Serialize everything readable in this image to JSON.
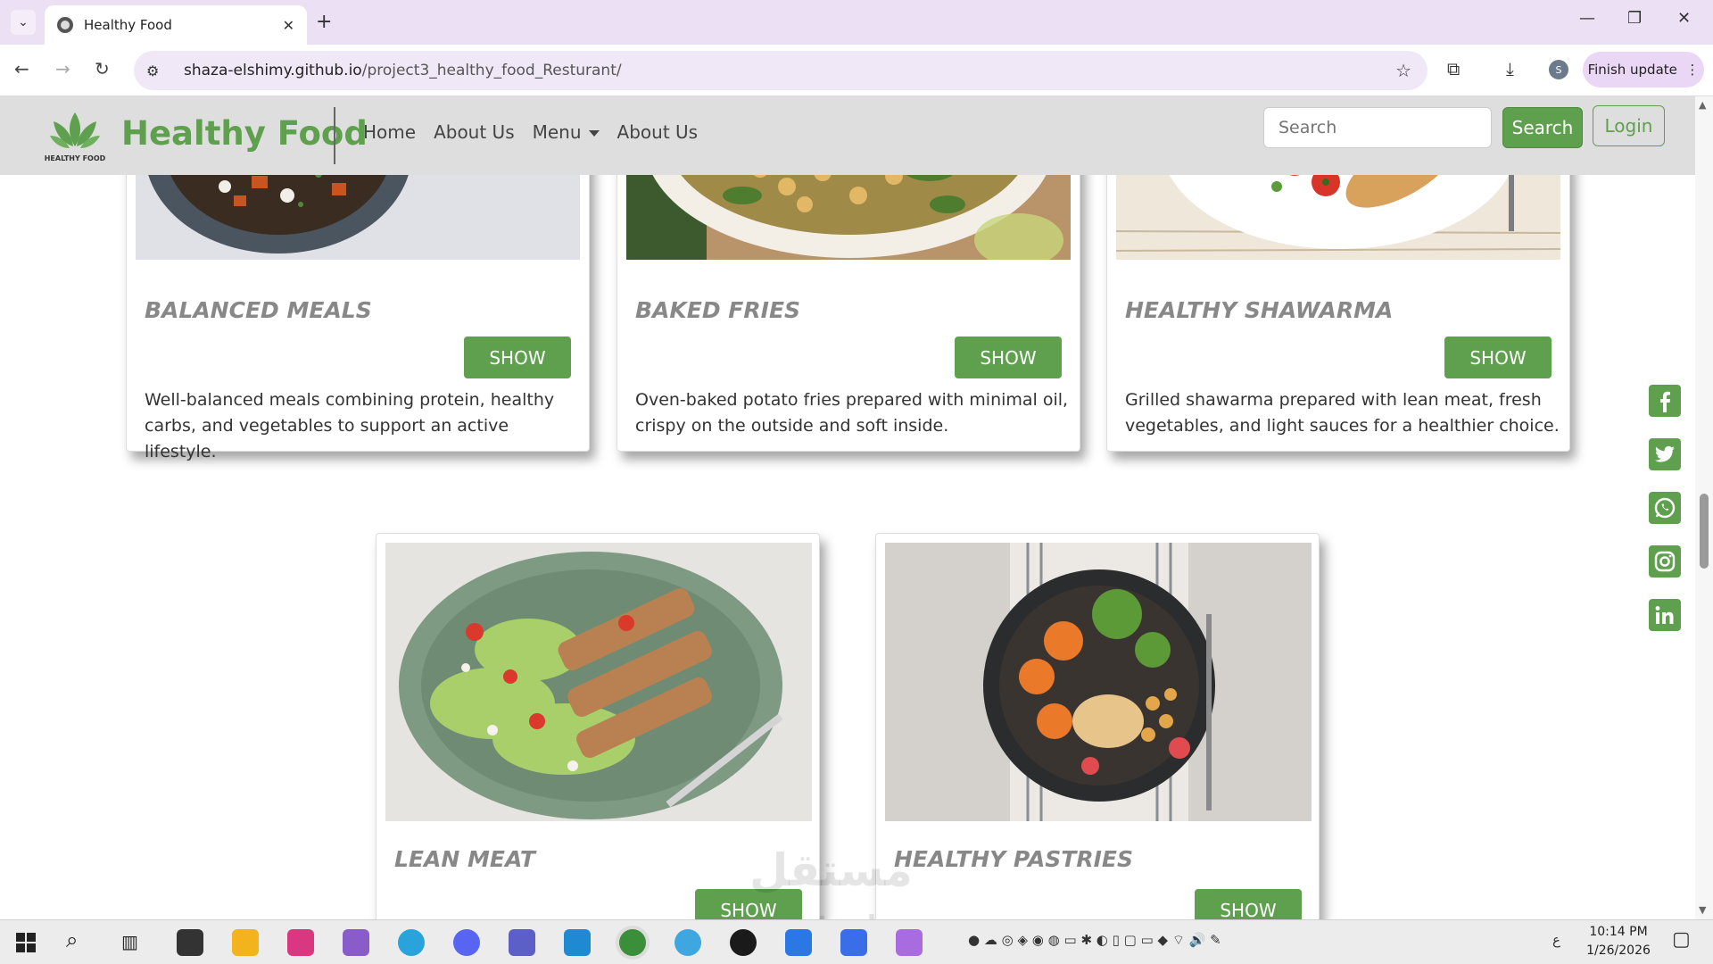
{
  "browser": {
    "tab_title": "Healthy Food",
    "tab_close": "✕",
    "new_tab": "+",
    "url_host": "shaza-elshimy.github.io",
    "url_path": "/project3_healthy_food_Resturant/",
    "profile_initial": "S",
    "finish_update": "Finish update"
  },
  "site": {
    "brand": "Healthy Food",
    "logo_text": "HEALTHY FOOD",
    "nav": [
      "Home",
      "About Us",
      "Menu",
      "About Us"
    ],
    "search_placeholder": "Search",
    "search_button": "Search",
    "login_button": "Login"
  },
  "cards": [
    {
      "title": "BALANCED MEALS",
      "button": "SHOW",
      "description": "Well-balanced meals combining protein, healthy carbs, and vegetables to support an active lifestyle."
    },
    {
      "title": "BAKED FRIES",
      "button": "SHOW",
      "description": "Oven-baked potato fries prepared with minimal oil, crispy on the outside and soft inside."
    },
    {
      "title": "HEALTHY SHAWARMA",
      "button": "SHOW",
      "description": "Grilled shawarma prepared with lean meat, fresh vegetables, and light sauces for a healthier choice."
    },
    {
      "title": "LEAN MEAT",
      "button": "SHOW"
    },
    {
      "title": "HEALTHY PASTRIES",
      "button": "SHOW"
    }
  ],
  "social": [
    "facebook-icon",
    "twitter-icon",
    "whatsapp-icon",
    "instagram-icon",
    "linkedin-icon"
  ],
  "watermark": {
    "line1": "مستقل",
    "line2": "mostaql.com"
  },
  "taskbar": {
    "time": "10:14 PM",
    "date": "1/26/2026",
    "lang": "ع"
  },
  "colors": {
    "accent": "#5fa04e",
    "navbar": "#dedede",
    "title_gray": "#888888",
    "chrome_tabbar": "#ece0f4"
  }
}
